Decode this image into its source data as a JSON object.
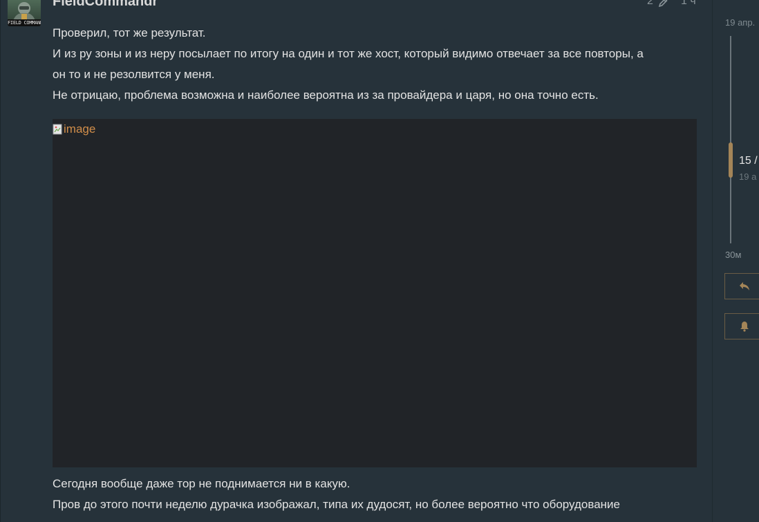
{
  "post": {
    "username": "FieldCommandr",
    "avatar_caption": "FIELD COMMANDE",
    "edit_count": "2",
    "age": "1 ч",
    "paragraphs_top": [
      "Проверил, тот же результат.",
      "И из ру зоны и из неру посылает по итогу на один и тот же хост, который видимо отвечает за все повторы, а",
      "он то и не резолвится у меня.",
      "Не отрицаю, проблема возможна и наиболее вероятна из за провайдера и царя, но она точно есть."
    ],
    "image_alt": "image",
    "paragraphs_bottom": [
      "Сегодня вообще даже тор не поднимается ни в какую.",
      "Пров до этого почти неделю дурачка изображал, типа их дудосят, но более вероятно что оборудование"
    ]
  },
  "timeline": {
    "top_date": "19 апр.",
    "position": "15 /",
    "position_date": "19 а",
    "bottom_date": "30м",
    "progress_fraction": 0.62
  },
  "buttons": {
    "reply_icon": "reply-icon",
    "notify_icon": "bell-icon"
  },
  "colors": {
    "background": "#26323a",
    "text": "#e3e3e3",
    "muted": "#8a9499",
    "accent": "#a48558",
    "link": "#d28e4a",
    "image_bg": "#212428"
  }
}
